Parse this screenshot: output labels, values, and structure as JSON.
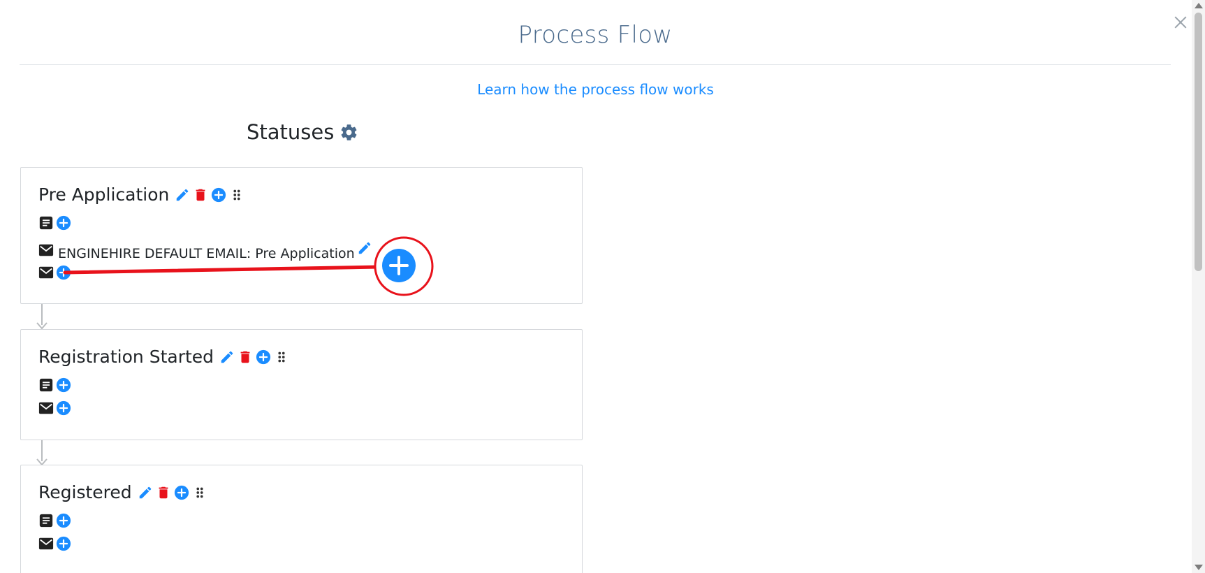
{
  "modal": {
    "title": "Process Flow",
    "learn_link": "Learn how the process flow works",
    "statuses_heading": "Statuses"
  },
  "statuses": [
    {
      "name": "Pre Application",
      "emails": [
        "ENGINEHIRE DEFAULT EMAIL: Pre Application"
      ]
    },
    {
      "name": "Registration Started",
      "emails": []
    },
    {
      "name": "Registered",
      "emails": []
    }
  ],
  "colors": {
    "title": "#4a6a8c",
    "link": "#1a8cff",
    "edit": "#1a8cff",
    "delete": "#e8121b",
    "add": "#1a8cff",
    "annotation": "#e8121b"
  },
  "icons": {
    "edit": "pencil-icon",
    "delete": "trash-icon",
    "add": "plus-circle-icon",
    "drag": "drag-handle-icon",
    "form": "document-icon",
    "email": "envelope-icon",
    "settings": "gear-icon",
    "close": "close-icon"
  }
}
